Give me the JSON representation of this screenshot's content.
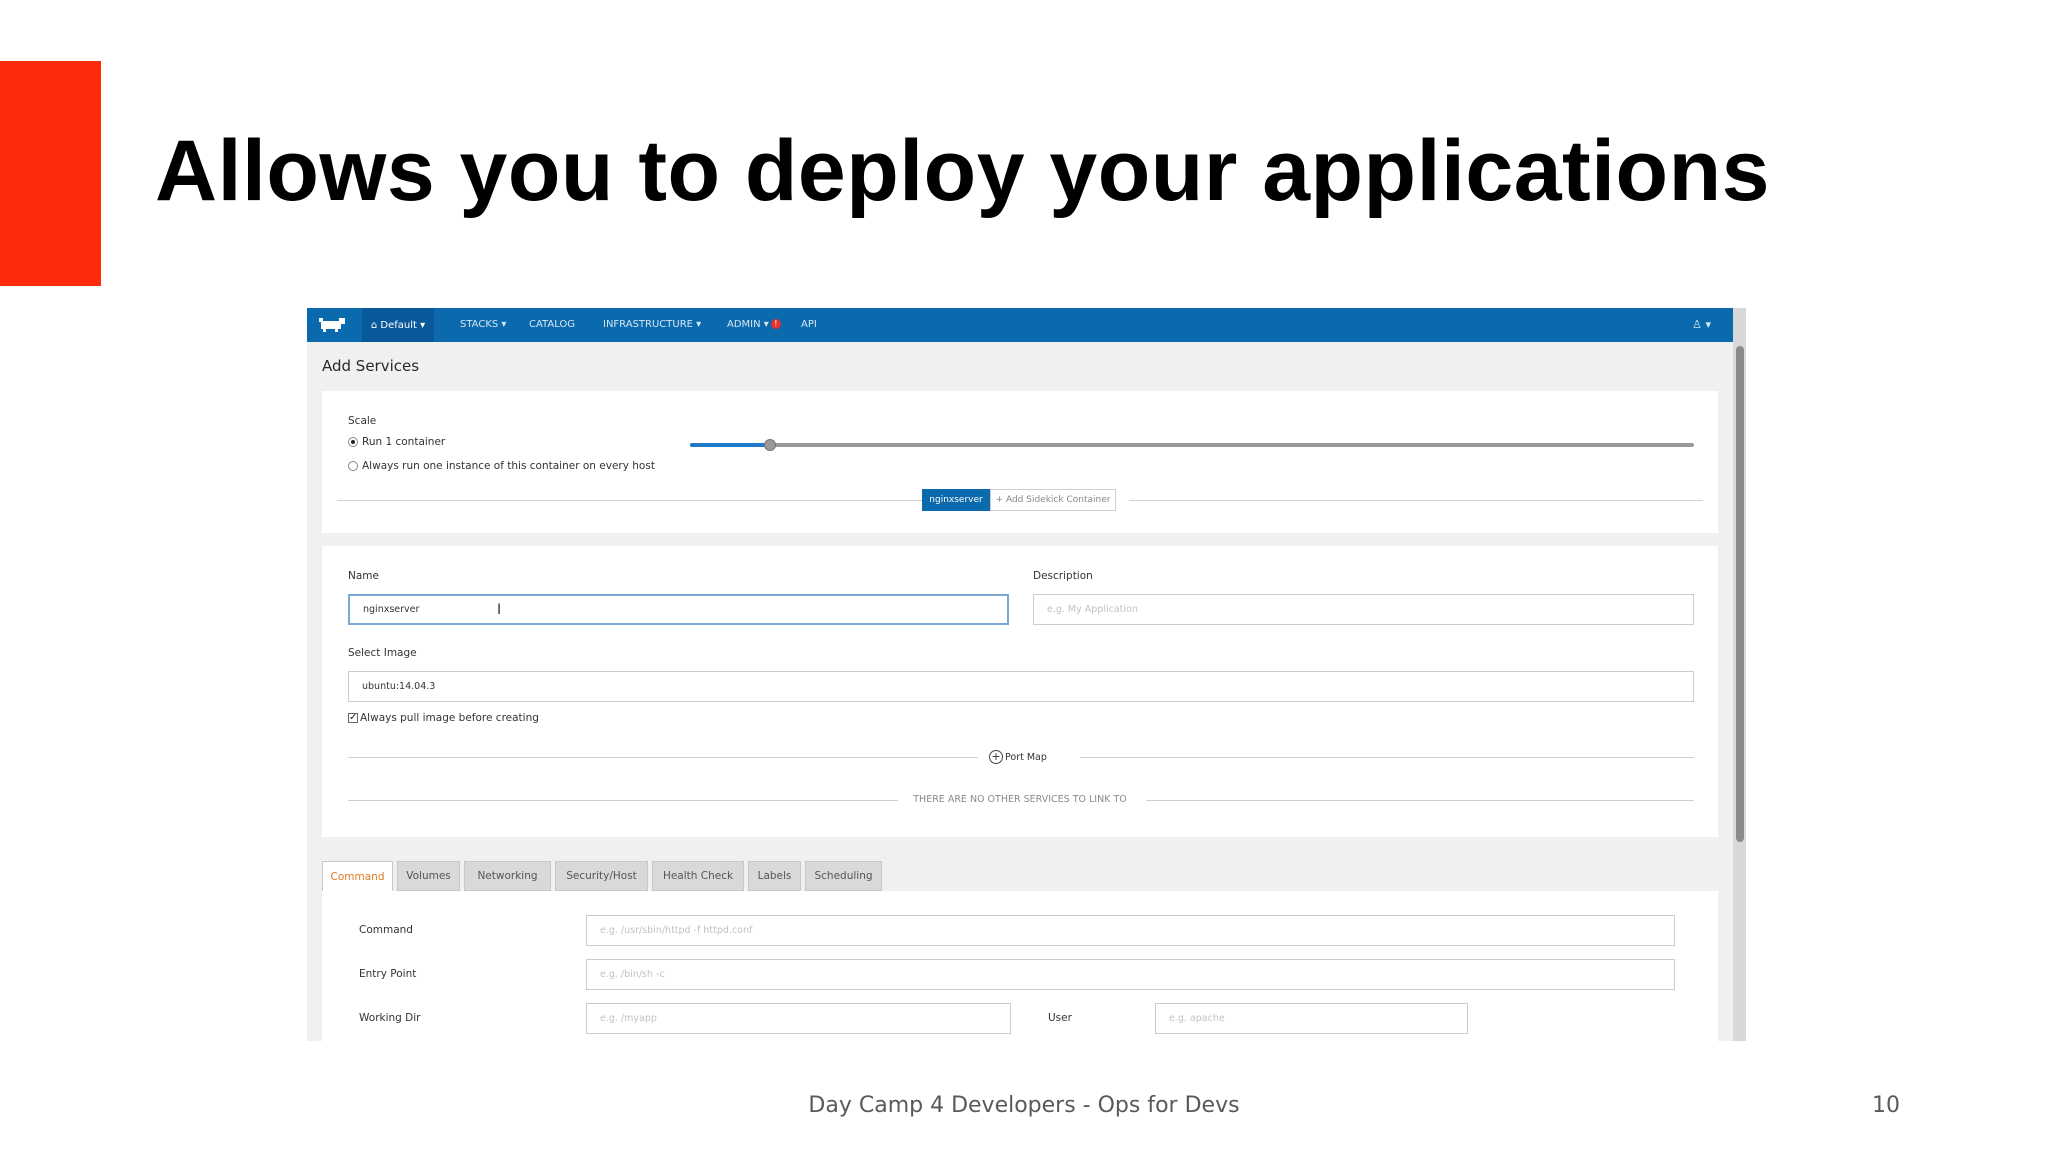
{
  "slide": {
    "title": "Allows you to deploy your applications",
    "footer": "Day Camp 4 Developers - Ops for Devs",
    "page_number": "10",
    "accent_color": "#ff2a0a"
  },
  "app": {
    "nav": {
      "environment": "⌂ Default ▾",
      "items": [
        "STACKS ▾",
        "CATALOG",
        "INFRASTRUCTURE ▾",
        "ADMIN ▾",
        "API"
      ],
      "admin_badge": "!",
      "user_menu": "♙ ▾",
      "brand_color": "#0b6aad"
    },
    "page_title": "Add Services",
    "scale": {
      "label": "Scale",
      "option_run": "Run 1 container",
      "option_always": "Always run one instance of this container on every host",
      "selected": "run",
      "slider_value": 1,
      "slider_fraction": 0.08
    },
    "containers": {
      "active": "nginxserver",
      "add_sidekick": "+ Add Sidekick Container"
    },
    "form": {
      "name_label": "Name",
      "name_value": "nginxserver",
      "description_label": "Description",
      "description_placeholder": "e.g. My Application",
      "image_label": "Select Image",
      "image_value": "ubuntu:14.04.3",
      "pull_label": "Always pull image before creating",
      "pull_checked": true,
      "port_map": "Port Map",
      "no_services": "THERE ARE NO OTHER SERVICES TO LINK TO"
    },
    "tabs": [
      "Command",
      "Volumes",
      "Networking",
      "Security/Host",
      "Health Check",
      "Labels",
      "Scheduling"
    ],
    "active_tab": "Command",
    "command": {
      "command_label": "Command",
      "command_placeholder": "e.g. /usr/sbin/httpd -f httpd.conf",
      "entry_label": "Entry Point",
      "entry_placeholder": "e.g. /bin/sh -c",
      "workdir_label": "Working Dir",
      "workdir_placeholder": "e.g. /myapp",
      "user_label": "User",
      "user_placeholder": "e.g. apache"
    }
  }
}
